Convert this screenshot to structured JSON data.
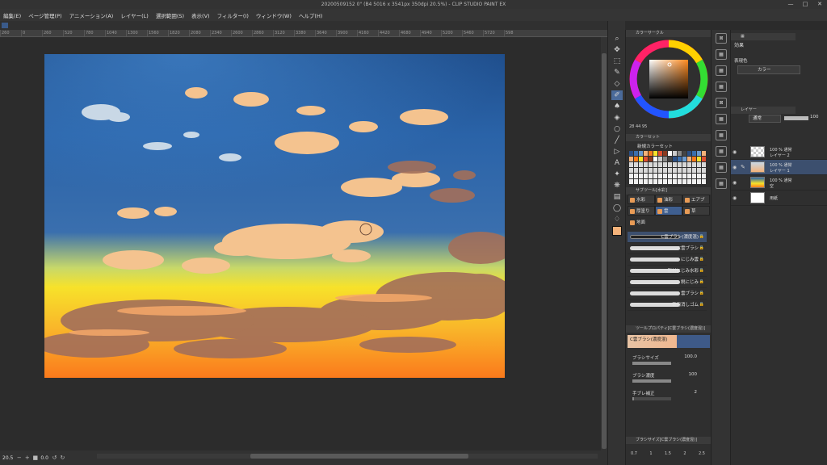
{
  "window": {
    "title": "20200509152 0\" (B4 5016 x 3541px 350dpi 20.5%) - CLIP STUDIO PAINT EX",
    "controls": [
      "—",
      "□",
      "✕"
    ]
  },
  "menu": [
    "編集(E)",
    "ページ管理(P)",
    "アニメーション(A)",
    "レイヤー(L)",
    "選択範囲(S)",
    "表示(V)",
    "フィルター(I)",
    "ウィンドウ(W)",
    "ヘルプ(H)"
  ],
  "ruler": [
    "260",
    "0",
    "260",
    "520",
    "780",
    "1040",
    "1300",
    "1560",
    "1820",
    "2080",
    "2340",
    "2600",
    "2860",
    "3120",
    "3380",
    "3640",
    "3900",
    "4160",
    "4420",
    "4680",
    "4940",
    "5200",
    "5460",
    "5720",
    "598"
  ],
  "status": {
    "zoom": "20.5",
    "angle": "0.0"
  },
  "color": {
    "fg": "#f4b27a",
    "panel_title": "カラーサークル",
    "hsv": "28  44  95"
  },
  "colorset": {
    "title": "カラーセット",
    "name": "新規カラーセット"
  },
  "subtool": {
    "title": "サブツール[水彩]",
    "tabs": [
      "水彩",
      "油彩",
      "エアブ",
      "厚塗り",
      "雲",
      "草"
    ],
    "group": "地面",
    "brushes": [
      "C雲ブラシ(濃度混)",
      "C雲ブラシ",
      "にじみ雲",
      "影付にじみ水彩",
      "鋭にじみ",
      "雲ブラシ",
      "雲用消しゴム"
    ]
  },
  "tool_property": {
    "title": "ツールプロパティ[C雲ブラシ(濃度混)]",
    "brush_name": "C雲ブラシ(濃度混)",
    "rows": [
      {
        "label": "ブラシサイズ",
        "value": "100.0",
        "level": 1.0
      },
      {
        "label": "ブラシ濃度",
        "value": "100",
        "level": 1.0
      },
      {
        "label": "手ブレ補正",
        "value": "2",
        "level": 0.04
      }
    ]
  },
  "brush_size": {
    "title": "ブラシサイズ[C雲ブラシ(濃度混)]",
    "sizes": [
      "0.7",
      "1",
      "1.5",
      "2",
      "2.5"
    ]
  },
  "right": {
    "effect_title": "効果",
    "expression_color_label": "表現色",
    "expression_color": "カラー",
    "layer_title": "レイヤー",
    "blend": "通常",
    "opacity": "100",
    "layers": [
      {
        "line1": "100 % 通常",
        "line2": "レイヤー 2",
        "selected": false
      },
      {
        "line1": "100 % 通常",
        "line2": "レイヤー 1",
        "selected": true
      },
      {
        "line1": "100 % 通常",
        "line2": "空",
        "selected": false
      },
      {
        "line1": "",
        "line2": "用紙",
        "selected": false
      }
    ]
  }
}
